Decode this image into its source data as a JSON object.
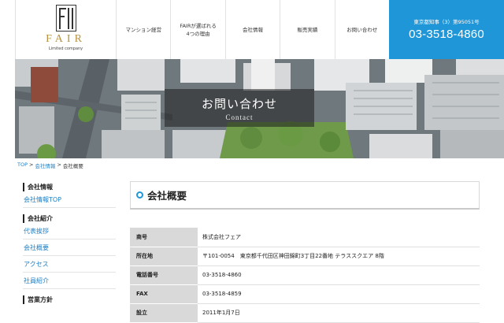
{
  "logo": {
    "brand": "FAIR",
    "tagline": "Limited company"
  },
  "nav": {
    "items": [
      {
        "lines": [
          "マンション経営"
        ]
      },
      {
        "lines": [
          "FAIRが選ばれる",
          "4つの理由"
        ]
      },
      {
        "lines": [
          "会社情報"
        ]
      },
      {
        "lines": [
          "販売実績"
        ]
      },
      {
        "lines": [
          "お問い合わせ"
        ]
      }
    ]
  },
  "contact": {
    "license": "東京都知事（3）第95051号",
    "tel": "03-3518-4860",
    "accent": "#1e96d8"
  },
  "hero": {
    "title": "お問い合わせ",
    "subtitle": "Contact"
  },
  "breadcrumb": {
    "items": [
      "TOP",
      "会社情報",
      "会社概要"
    ],
    "separator": ">"
  },
  "sidebar": {
    "sections": [
      {
        "heading": "会社情報",
        "links": [
          "会社情報TOP"
        ]
      },
      {
        "heading": "会社紹介",
        "links": [
          "代表挨拶",
          "会社概要",
          "アクセス",
          "社員紹介"
        ]
      },
      {
        "heading": "営業方針",
        "links": []
      }
    ]
  },
  "main": {
    "title": "会社概要",
    "table": [
      {
        "label": "商号",
        "value": "株式会社フェア"
      },
      {
        "label": "所在地",
        "value": "〒101-0054　東京都千代田区神田錦町3丁目22番地 テラススクエア 8階"
      },
      {
        "label": "電話番号",
        "value": "03-3518-4860"
      },
      {
        "label": "FAX",
        "value": "03-3518-4859"
      },
      {
        "label": "設立",
        "value": "2011年1月7日"
      }
    ]
  }
}
